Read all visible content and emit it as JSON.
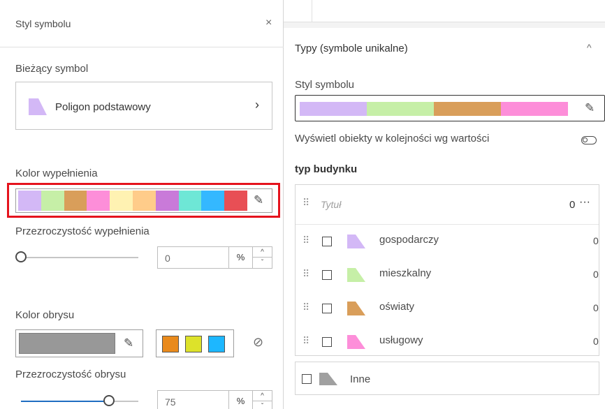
{
  "left_panel": {
    "title": "Styl symbolu",
    "close_icon": "×",
    "current_symbol": {
      "label": "Bieżący symbol",
      "name": "Poligon podstawowy",
      "chevron": "›"
    },
    "fill_color": {
      "label": "Kolor wypełnienia",
      "ramp_colors": [
        "#d3b8f6",
        "#c6efa7",
        "#d99e5a",
        "#fd8ed9",
        "#fff2b2",
        "#ffcc8a",
        "#c97ad9",
        "#6ee7d6",
        "#34b8ff",
        "#e84f55"
      ]
    },
    "fill_transparency": {
      "label": "Przezroczystość wypełnienia",
      "value": "0",
      "percent": 0,
      "unit": "%"
    },
    "outline_color": {
      "label": "Kolor obrysu",
      "color": "#989898",
      "recent_colors": [
        "#e98a1c",
        "#dde22a",
        "#1db7ff"
      ],
      "no_color_icon": "⊘"
    },
    "outline_transparency": {
      "label": "Przezroczystość obrysu",
      "value": "75",
      "percent": 75,
      "unit": "%"
    },
    "step_up": "^",
    "step_down": "ˇ"
  },
  "right_panel": {
    "title": "Typy (symbole unikalne)",
    "collapse_icon": "^",
    "style_label": "Styl symbolu",
    "style_ramp_colors": [
      "#d3b8f6",
      "#c6efa7",
      "#d99e5a",
      "#fd8ed9"
    ],
    "order_toggle_label": "Wyświetl obiekty w kolejności wg wartości",
    "field_name": "typ budynku",
    "list": {
      "title_placeholder": "Tytuł",
      "total": "0",
      "more_icon": "···",
      "items": [
        {
          "name": "gospodarczy",
          "count": "0",
          "color": "#d3b8f6"
        },
        {
          "name": "mieszkalny",
          "count": "0",
          "color": "#c6efa7"
        },
        {
          "name": "oświaty",
          "count": "0",
          "color": "#d99e5a"
        },
        {
          "name": "usługowy",
          "count": "0",
          "color": "#fd8ed9"
        }
      ]
    },
    "other": {
      "name": "Inne",
      "color": "#a0a0a0"
    }
  },
  "icons": {
    "pencil": "✎",
    "grip": "⠿"
  }
}
